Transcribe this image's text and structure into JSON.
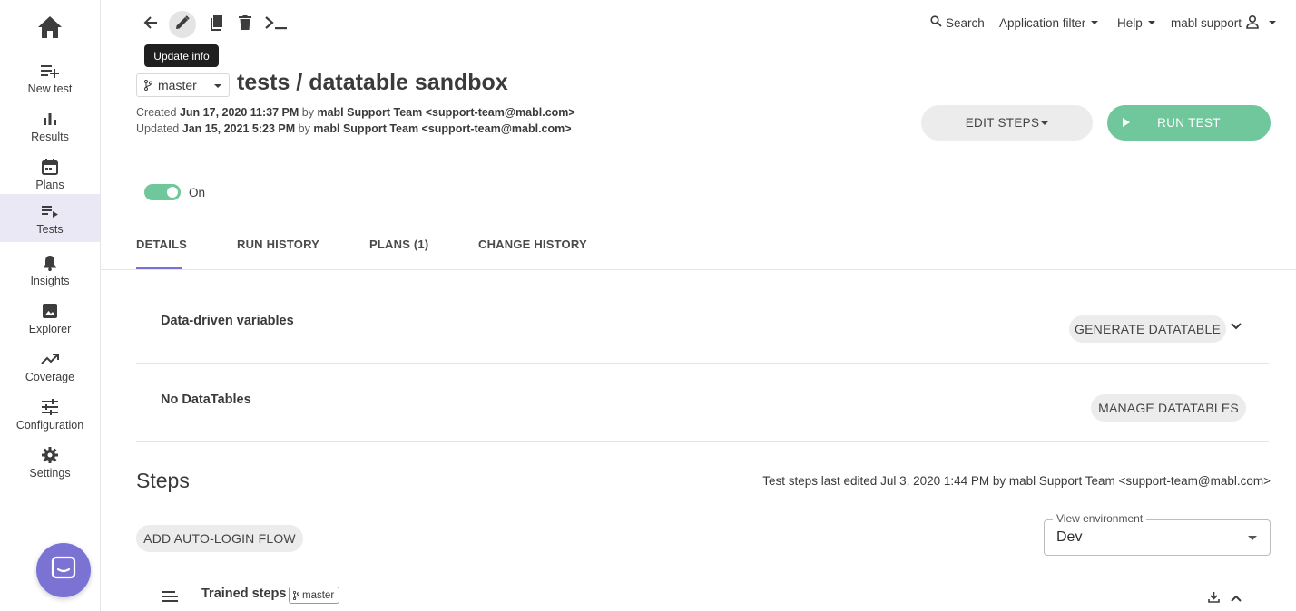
{
  "sidebar": {
    "items": [
      {
        "label": "New test"
      },
      {
        "label": "Results"
      },
      {
        "label": "Plans"
      },
      {
        "label": "Tests"
      },
      {
        "label": "Insights"
      },
      {
        "label": "Explorer"
      },
      {
        "label": "Coverage"
      },
      {
        "label": "Configuration"
      },
      {
        "label": "Settings"
      }
    ],
    "active": "Tests",
    "accent": "#7b73d4"
  },
  "toolbar": {
    "tooltip": "Update info"
  },
  "topnav": {
    "search": "Search",
    "app_filter": "Application filter",
    "help": "Help",
    "user": "mabl support"
  },
  "header": {
    "branch": "master",
    "title": "tests / datatable sandbox",
    "created_prefix": "Created",
    "created_date": "Jun 17, 2020 11:37 PM",
    "created_by_word": "by",
    "created_by": "mabl Support Team <support-team@mabl.com>",
    "updated_prefix": "Updated",
    "updated_date": "Jan 15, 2021 5:23 PM",
    "updated_by_word": "by",
    "updated_by": "mabl Support Team <support-team@mabl.com>"
  },
  "actions": {
    "edit_steps": "EDIT STEPS",
    "run_test": "RUN TEST",
    "run_color": "#6fc79b"
  },
  "toggle": {
    "label": "On",
    "state": true
  },
  "tabs": [
    {
      "label": "DETAILS",
      "active": true
    },
    {
      "label": "RUN HISTORY"
    },
    {
      "label": "PLANS (1)"
    },
    {
      "label": "CHANGE HISTORY"
    }
  ],
  "details": {
    "ddv_label": "Data-driven variables",
    "generate_btn": "GENERATE DATATABLE",
    "no_tables_label": "No DataTables",
    "manage_btn": "MANAGE DATATABLES"
  },
  "steps": {
    "title": "Steps",
    "meta": "Test steps last edited Jul 3, 2020 1:44 PM by mabl Support Team <support-team@mabl.com>",
    "auto_login_btn": "ADD AUTO-LOGIN FLOW",
    "env_label": "View environment",
    "env_value": "Dev",
    "trained_label": "Trained steps",
    "trained_branch": "master"
  }
}
